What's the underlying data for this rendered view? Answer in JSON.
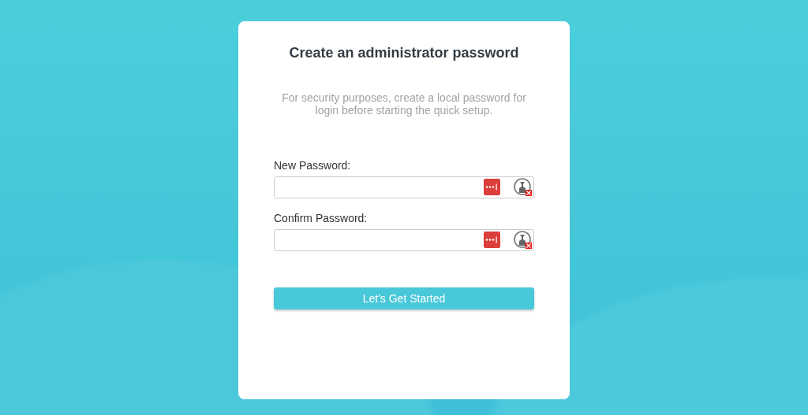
{
  "dialog": {
    "title": "Create an administrator password",
    "description": "For security purposes, create a local password for login before starting the quick setup.",
    "fields": [
      {
        "label": "New Password:"
      },
      {
        "label": "Confirm Password:"
      }
    ],
    "button": {
      "label": "Let's Get Started"
    }
  }
}
